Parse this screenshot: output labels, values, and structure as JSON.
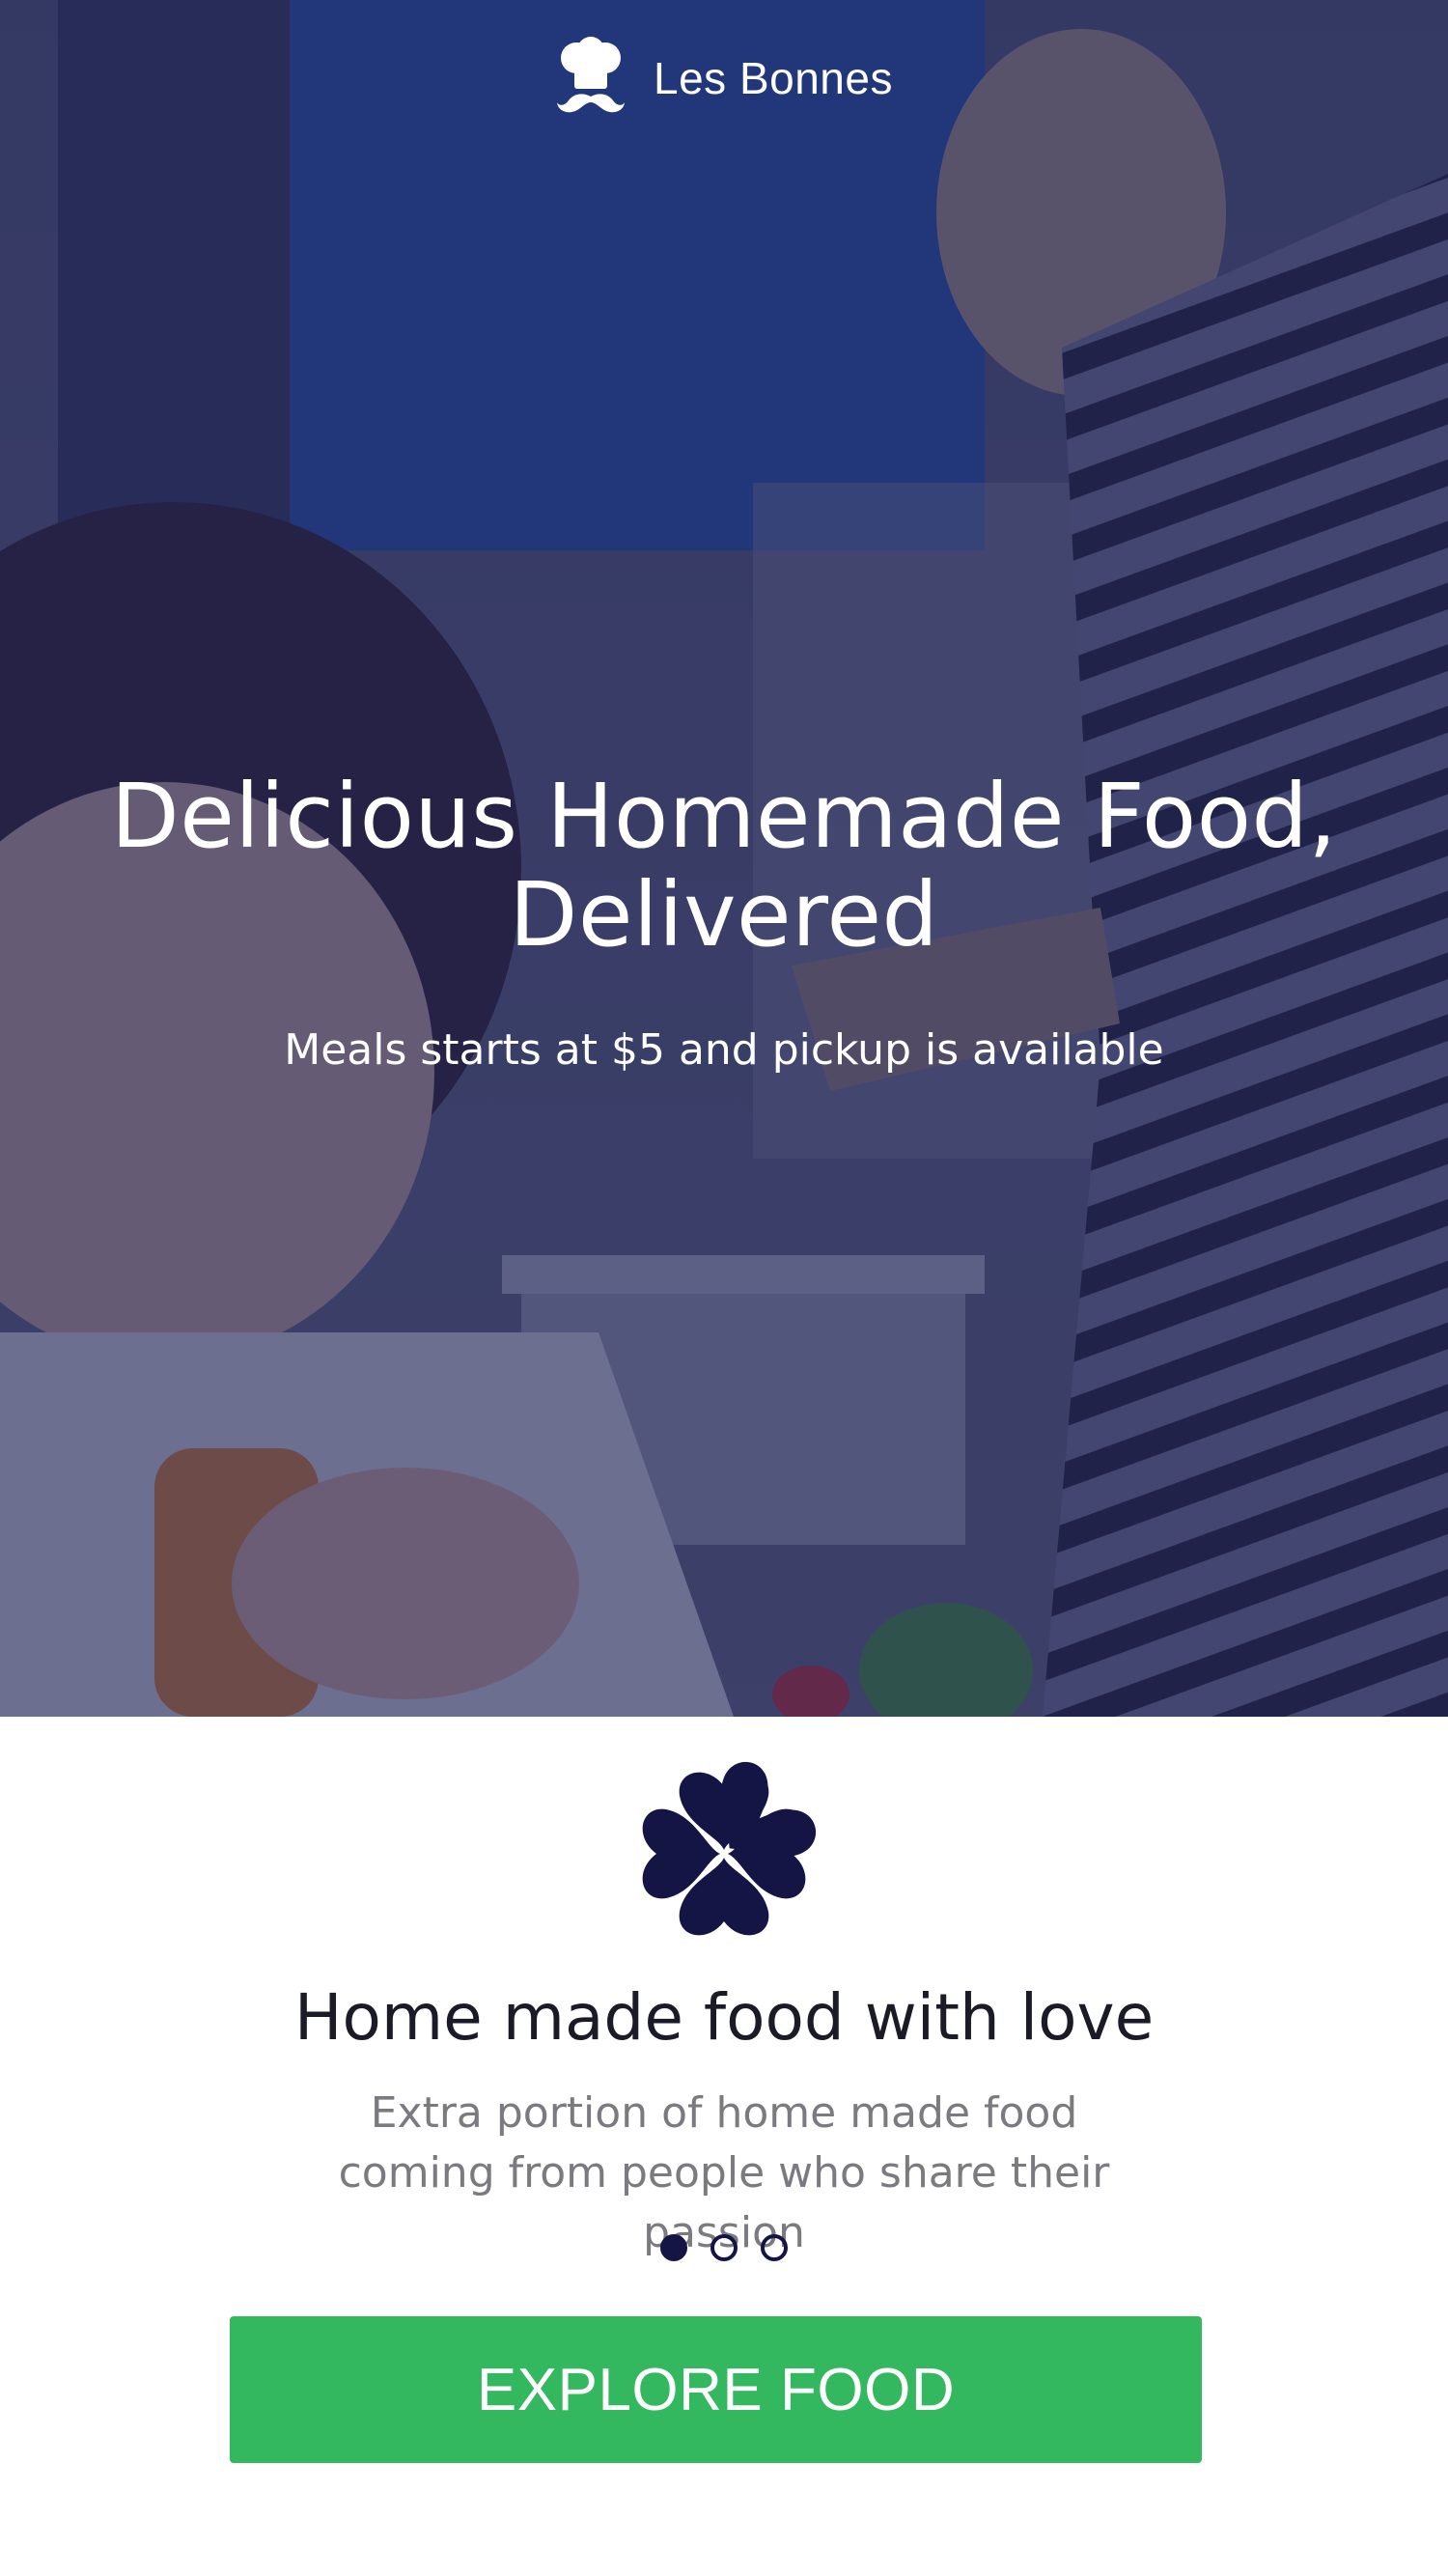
{
  "hero": {
    "brand_name": "Les Bonnes",
    "title": "Delicious Homemade Food, Delivered",
    "subtitle": "Meals starts at $5 and pickup is available"
  },
  "feature": {
    "icon": "clover-icon",
    "title": "Home made food with love",
    "description": "Extra portion of home made food coming from people who share their passion"
  },
  "pager": {
    "total": 3,
    "active_index": 0
  },
  "cta": {
    "label": "EXPLORE FOOD"
  },
  "colors": {
    "overlay": "#222454",
    "accent_navy": "#141544",
    "cta_green": "#33b85f",
    "text_dark": "#1b1b28",
    "text_muted": "#7a7a80"
  }
}
